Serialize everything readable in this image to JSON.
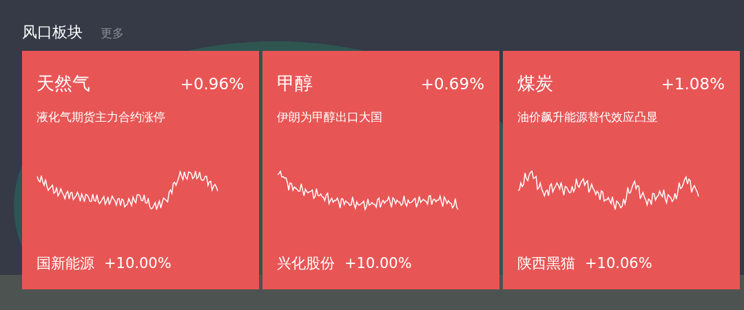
{
  "header": {
    "title": "风口板块",
    "more_link": "更多"
  },
  "cards": [
    {
      "name": "天然气",
      "change": "+0.96%",
      "headline": "液化气期货主力合约涨停",
      "stock": "国新能源",
      "stock_change": "+10.00%"
    },
    {
      "name": "甲醇",
      "change": "+0.69%",
      "headline": "伊朗为甲醇出口大国",
      "stock": "兴化股份",
      "stock_change": "+10.00%"
    },
    {
      "name": "煤炭",
      "change": "+1.08%",
      "headline": "油价飙升能源替代效应凸显",
      "stock": "陕西黑猫",
      "stock_change": "+10.06%"
    }
  ]
}
